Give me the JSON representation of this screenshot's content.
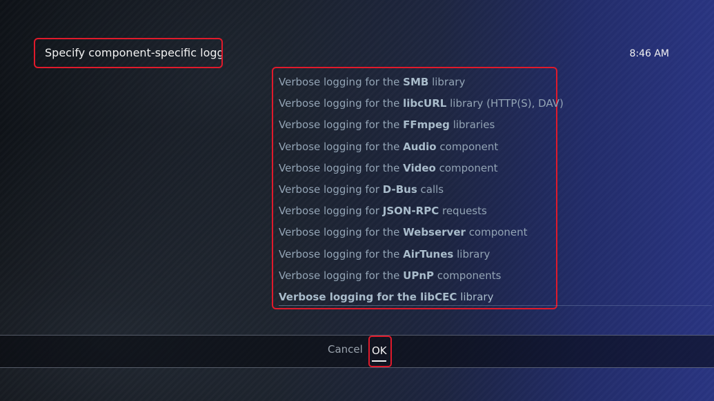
{
  "dialog": {
    "heading": "Specify component-specific logging...",
    "clock": "8:46 AM"
  },
  "list": {
    "items": [
      {
        "prefix": "Verbose logging for the ",
        "keyword": "SMB",
        "suffix": " library"
      },
      {
        "prefix": "Verbose logging for the ",
        "keyword": "libcURL",
        "suffix": " library (HTTP(S), DAV)"
      },
      {
        "prefix": "Verbose logging for the ",
        "keyword": "FFmpeg",
        "suffix": " libraries"
      },
      {
        "prefix": "Verbose logging for the ",
        "keyword": "Audio",
        "suffix": " component"
      },
      {
        "prefix": "Verbose logging for the ",
        "keyword": "Video",
        "suffix": " component"
      },
      {
        "prefix": "Verbose logging for ",
        "keyword": "D-Bus",
        "suffix": " calls"
      },
      {
        "prefix": "Verbose logging for ",
        "keyword": "JSON-RPC",
        "suffix": " requests"
      },
      {
        "prefix": "Verbose logging for the ",
        "keyword": "Webserver",
        "suffix": " component"
      },
      {
        "prefix": "Verbose logging for the ",
        "keyword": "AirTunes",
        "suffix": " library"
      },
      {
        "prefix": "Verbose logging for the ",
        "keyword": "UPnP",
        "suffix": " components"
      },
      {
        "prefix": "Verbose logging for the ",
        "keyword": "libCEC",
        "suffix": " library"
      }
    ]
  },
  "buttons": {
    "cancel_label": "Cancel",
    "ok_label": "OK"
  }
}
